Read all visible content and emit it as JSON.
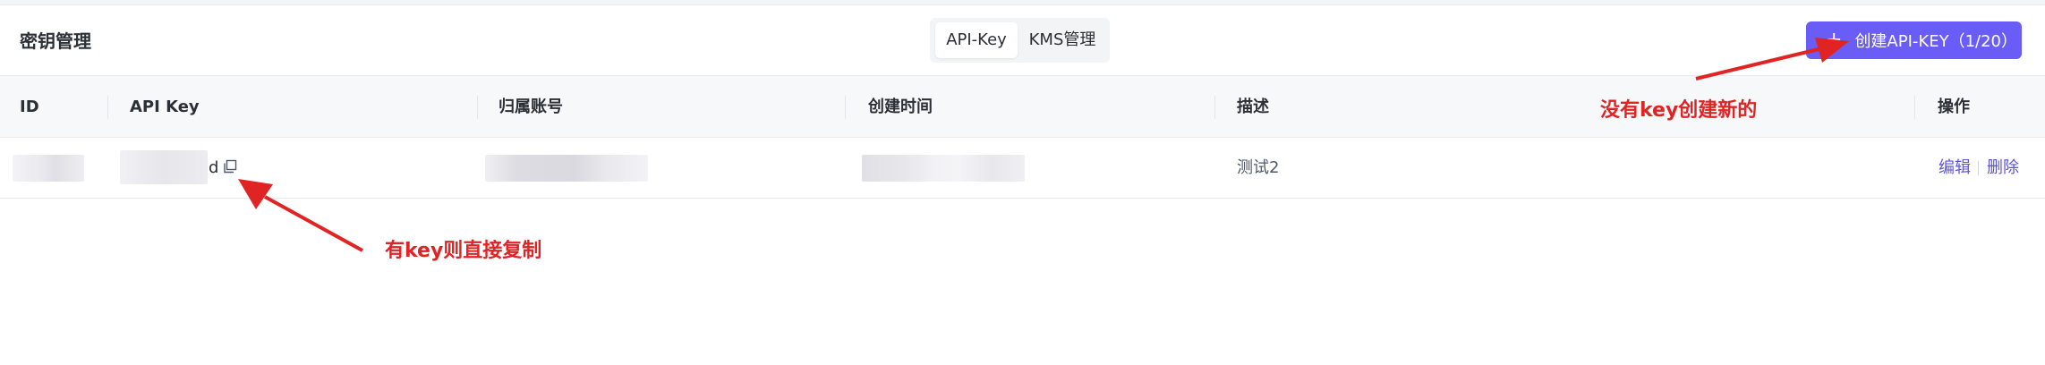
{
  "header": {
    "title": "密钥管理",
    "tabs": [
      {
        "label": "API-Key",
        "active": true
      },
      {
        "label": "KMS管理",
        "active": false
      }
    ],
    "create_button_label": "创建API-KEY（1/20）"
  },
  "table": {
    "columns": [
      "ID",
      "API Key",
      "归属账号",
      "创建时间",
      "描述",
      "操作"
    ],
    "rows": [
      {
        "api_key_suffix": "d",
        "description": "测试2",
        "actions": [
          "编辑",
          "删除"
        ]
      }
    ]
  },
  "annotations": {
    "create_hint": "没有key创建新的",
    "copy_hint": "有key则直接复制"
  },
  "colors": {
    "accent": "#6a5cf6",
    "link": "#5b53e6",
    "annotation": "#e02424"
  },
  "icons": [
    "plus-icon",
    "copy-icon",
    "red-arrow"
  ]
}
